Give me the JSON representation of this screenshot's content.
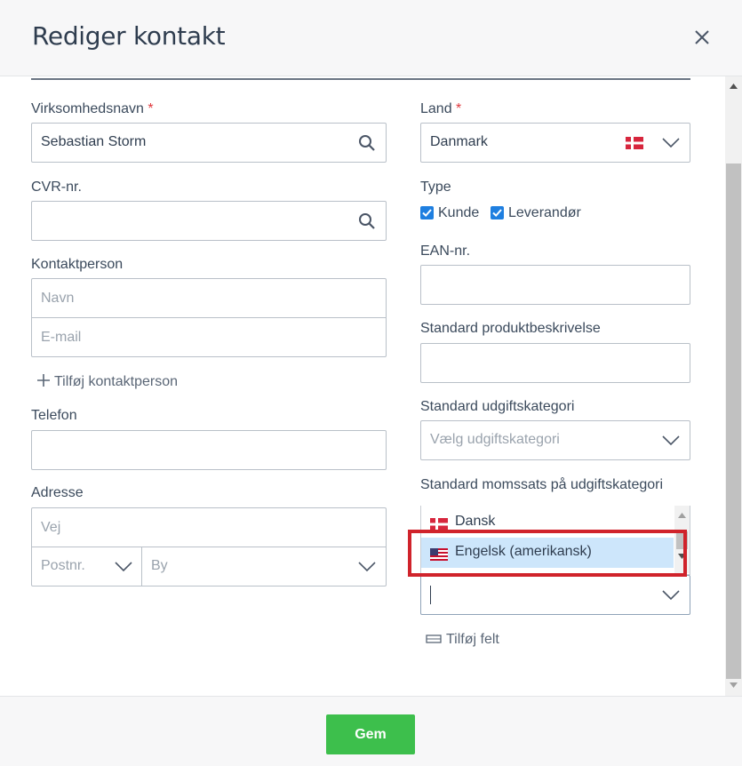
{
  "dialog": {
    "title": "Rediger kontakt"
  },
  "left": {
    "company": {
      "label": "Virksomhedsnavn",
      "required_mark": "*",
      "value": "Sebastian Storm"
    },
    "cvr": {
      "label": "CVR-nr.",
      "value": ""
    },
    "contact_person": {
      "label": "Kontaktperson",
      "name_placeholder": "Navn",
      "email_placeholder": "E-mail",
      "add_label": "Tilføj kontaktperson"
    },
    "phone": {
      "label": "Telefon",
      "value": ""
    },
    "address": {
      "label": "Adresse",
      "street_placeholder": "Vej",
      "zip_placeholder": "Postnr.",
      "city_placeholder": "By"
    }
  },
  "right": {
    "country": {
      "label": "Land",
      "required_mark": "*",
      "value": "Danmark"
    },
    "type": {
      "label": "Type",
      "options": [
        {
          "label": "Kunde",
          "checked": true
        },
        {
          "label": "Leverandør",
          "checked": true
        }
      ]
    },
    "ean": {
      "label": "EAN-nr.",
      "value": ""
    },
    "product_description": {
      "label": "Standard produktbeskrivelse",
      "value": ""
    },
    "expense_category": {
      "label": "Standard udgiftskategori",
      "placeholder": "Vælg udgiftskategori"
    },
    "vat_rate": {
      "label": "Standard momssats på udgiftskategori"
    },
    "language_dropdown": {
      "options": [
        {
          "label": "Dansk",
          "flag": "dk-flag-icon"
        },
        {
          "label": "Engelsk (amerikansk)",
          "flag": "us-flag-icon",
          "selected": true
        }
      ]
    },
    "add_field_label": "Tilføj felt"
  },
  "footer": {
    "save_label": "Gem"
  },
  "colors": {
    "accent": "#1f7fe0",
    "save": "#3dbf4c",
    "required": "#e0393e",
    "highlight": "#d0232b",
    "selected_item": "#cde6fb"
  }
}
